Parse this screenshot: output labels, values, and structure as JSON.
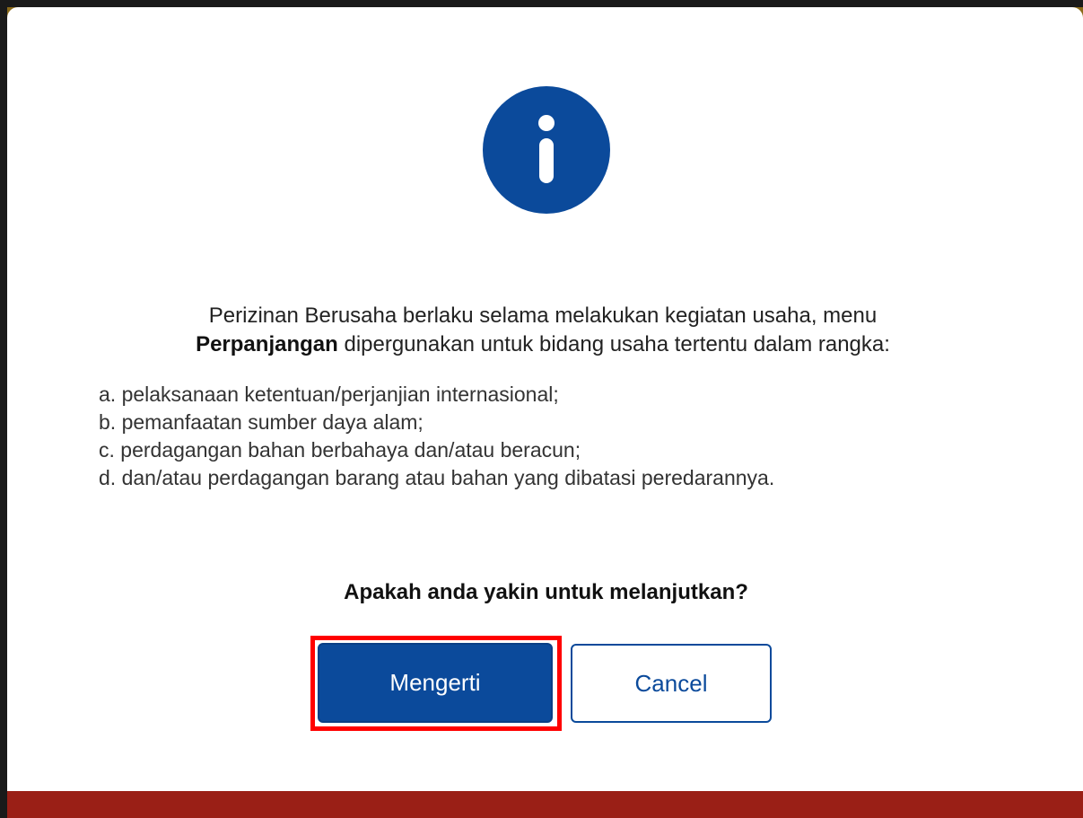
{
  "dialog": {
    "icon": "info-circle-icon",
    "message_line1": "Perizinan Berusaha berlaku selama melakukan kegiatan usaha, menu",
    "message_bold": "Perpanjangan",
    "message_line2_rest": " dipergunakan untuk bidang usaha tertentu dalam rangka:",
    "list_items": [
      "a. pelaksanaan ketentuan/perjanjian internasional;",
      "b. pemanfaatan sumber daya alam;",
      "c. perdagangan bahan berbahaya dan/atau beracun;",
      "d. dan/atau perdagangan barang atau bahan yang dibatasi peredarannya."
    ],
    "question": "Apakah anda yakin untuk melanjutkan?",
    "confirm_label": "Mengerti",
    "cancel_label": "Cancel"
  },
  "colors": {
    "primary": "#0b4a9b",
    "highlight": "#ff0000",
    "bottom_bar": "#9a1f16"
  }
}
